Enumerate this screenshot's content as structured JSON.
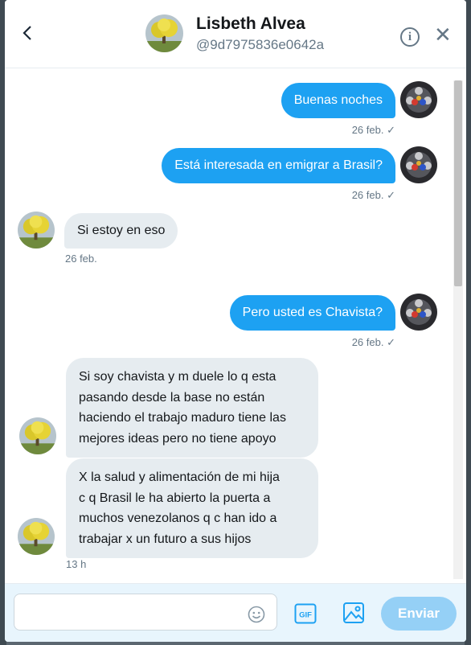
{
  "header": {
    "name": "Lisbeth Alvea",
    "handle": "@9d7975836e0642a",
    "back_icon": "chevron-left-icon",
    "info_glyph": "i",
    "close_glyph": "✕"
  },
  "messages": [
    {
      "direction": "out",
      "text": "Buenas noches",
      "time": "26 feb.",
      "check": "✓"
    },
    {
      "direction": "out",
      "text": "Está interesada en emigrar a Brasil?",
      "time": "26 feb.",
      "check": "✓"
    },
    {
      "direction": "in",
      "text": "Si estoy en eso",
      "time": "26 feb."
    },
    {
      "direction": "out",
      "text": "Pero usted es Chavista?",
      "time": "26 feb.",
      "check": "✓"
    },
    {
      "direction": "in",
      "lines": [
        "Si soy chavista y m duele lo q esta",
        "pasando desde la base no están",
        "haciendo el trabajo maduro tiene las",
        "mejores ideas pero no tiene apoyo"
      ]
    },
    {
      "direction": "in",
      "lines": [
        "X la salud y alimentación de mi hija",
        "c q Brasil le ha abierto la puerta a",
        "muchos venezolanos q c han ido a",
        "trabajar x un futuro a sus hijos"
      ],
      "time": "13 h"
    }
  ],
  "composer": {
    "placeholder": "",
    "gif_label": "GIF",
    "send_label": "Enviar"
  },
  "colors": {
    "accent": "#1da1f2",
    "send_disabled": "#95d0f6",
    "incoming_bubble": "#e6ecf0"
  }
}
